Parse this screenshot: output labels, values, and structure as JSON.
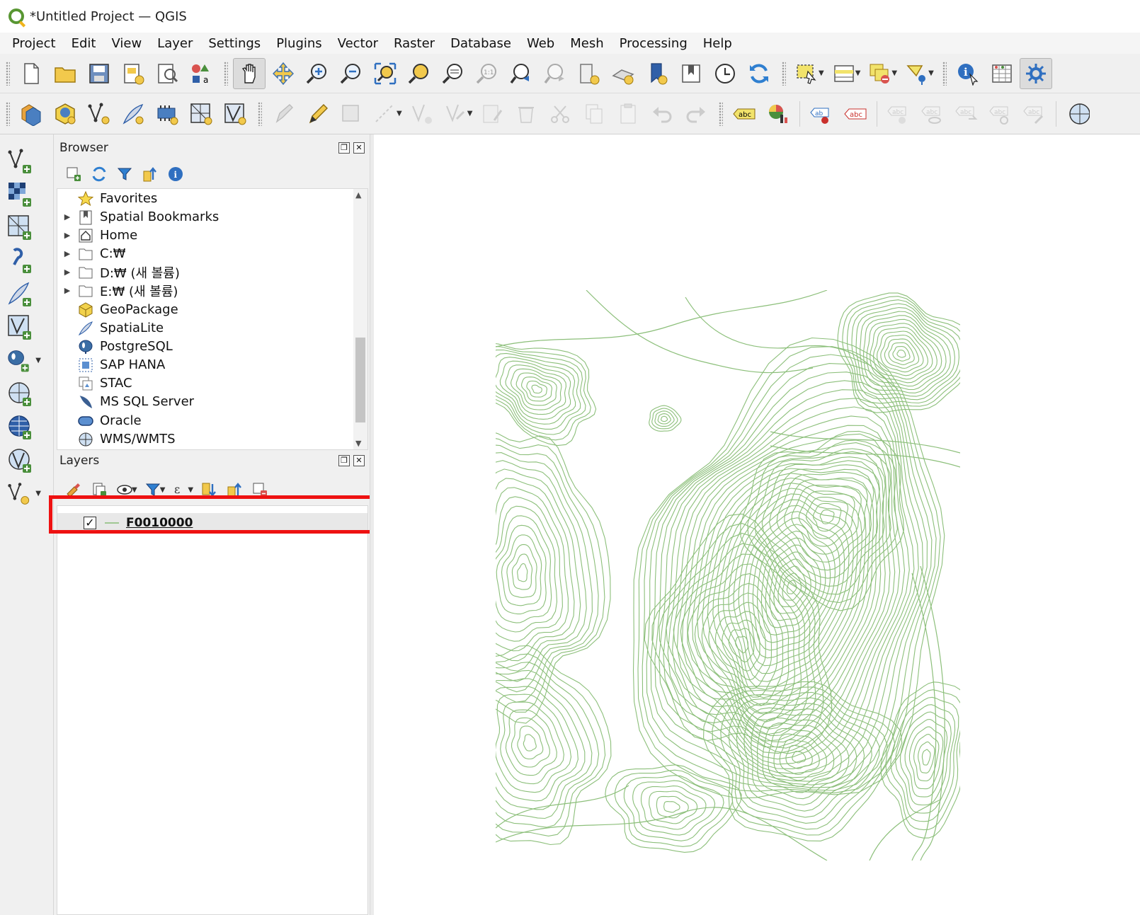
{
  "window": {
    "title": "*Untitled Project — QGIS"
  },
  "menu": [
    "Project",
    "Edit",
    "View",
    "Layer",
    "Settings",
    "Plugins",
    "Vector",
    "Raster",
    "Database",
    "Web",
    "Mesh",
    "Processing",
    "Help"
  ],
  "toolbar1": [
    "new-project-icon",
    "open-project-icon",
    "save-project-icon",
    "new-print-layout-icon",
    "layout-manager-icon",
    "style-manager-icon",
    "pan-icon",
    "pan-to-selection-icon",
    "zoom-in-icon",
    "zoom-out-icon",
    "zoom-full-icon",
    "zoom-to-selection-icon",
    "zoom-to-layer-icon",
    "zoom-native-icon",
    "zoom-last-icon",
    "zoom-next-icon",
    "new-map-view-icon",
    "new-3d-map-view-icon",
    "new-bookmark-icon",
    "show-bookmarks-icon",
    "temporal-controller-icon",
    "refresh-icon",
    "select-features-icon",
    "attribute-selection-icon",
    "deselect-icon",
    "select-by-location-icon",
    "identify-icon",
    "attribute-table-icon",
    "processing-toolbox-icon"
  ],
  "toolbar2": [
    "data-source-manager-icon",
    "new-geopackage-layer-icon",
    "new-shapefile-layer-icon",
    "new-spatialite-layer-icon",
    "new-temporary-layer-icon",
    "new-virtual-layer-icon",
    "new-mesh-layer-icon",
    "current-edits-icon",
    "toggle-editing-icon",
    "save-edits-icon",
    "digitize-line-icon",
    "vertex-tool-icon",
    "modify-attributes-icon",
    "delete-selected-icon",
    "cut-features-icon",
    "copy-features-icon",
    "paste-features-icon",
    "undo-icon",
    "redo-icon",
    "label-toolbar-icon",
    "diagram-icon",
    "label-pin-icon",
    "label-highlight-icon",
    "label-move-icon",
    "label-show-hide-icon",
    "label-rotate-icon",
    "label-change-icon",
    "label-edit-icon",
    "globe-icon"
  ],
  "left_toolbar": [
    "add-vector-layer-icon",
    "add-raster-layer-icon",
    "add-mesh-layer-icon",
    "add-delimited-text-icon",
    "add-spatialite-icon",
    "add-virtual-layer-icon",
    "add-postgis-icon",
    "add-wms-icon",
    "add-wcs-icon",
    "add-wfs-icon",
    "add-new-layer-icon"
  ],
  "browser": {
    "title": "Browser",
    "items": [
      {
        "label": "Favorites",
        "expandable": false,
        "icon": "star-icon"
      },
      {
        "label": "Spatial Bookmarks",
        "expandable": true,
        "icon": "bookmark-icon"
      },
      {
        "label": "Home",
        "expandable": true,
        "icon": "home-icon"
      },
      {
        "label": "C:₩",
        "expandable": true,
        "icon": "folder-icon"
      },
      {
        "label": "D:₩ (새 볼륨)",
        "expandable": true,
        "icon": "folder-icon"
      },
      {
        "label": "E:₩ (새 볼륨)",
        "expandable": true,
        "icon": "folder-icon"
      },
      {
        "label": "GeoPackage",
        "expandable": false,
        "icon": "geopackage-icon"
      },
      {
        "label": "SpatiaLite",
        "expandable": false,
        "icon": "spatialite-icon"
      },
      {
        "label": "PostgreSQL",
        "expandable": false,
        "icon": "postgresql-icon"
      },
      {
        "label": "SAP HANA",
        "expandable": false,
        "icon": "sap-hana-icon"
      },
      {
        "label": "STAC",
        "expandable": false,
        "icon": "stac-icon"
      },
      {
        "label": "MS SQL Server",
        "expandable": false,
        "icon": "mssql-icon"
      },
      {
        "label": "Oracle",
        "expandable": false,
        "icon": "oracle-icon"
      },
      {
        "label": "WMS/WMTS",
        "expandable": false,
        "icon": "wms-icon"
      }
    ]
  },
  "layers": {
    "title": "Layers",
    "items": [
      {
        "name": "F0010000",
        "checked": "✓"
      }
    ]
  },
  "colors": {
    "contour": "#8cbf7a",
    "highlight": "#ee1111"
  }
}
